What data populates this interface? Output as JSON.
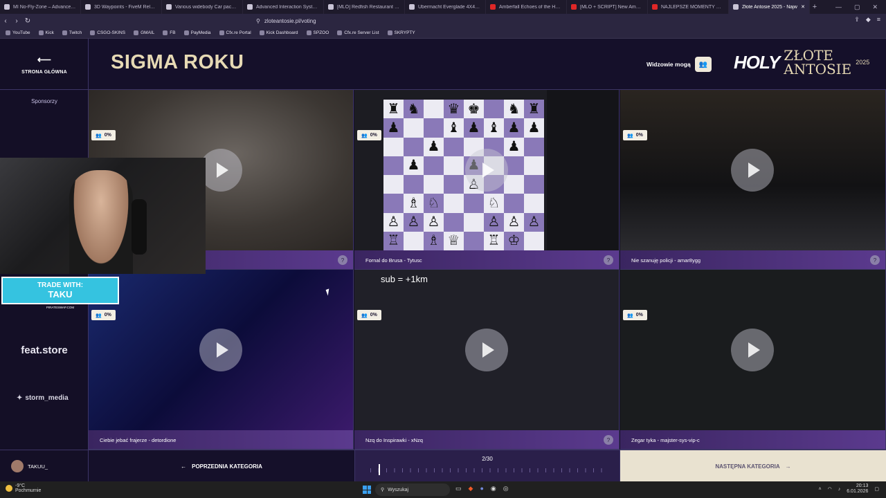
{
  "browser": {
    "tabs": [
      {
        "title": "MI No-Fly-Zone – Advanced Airsp",
        "icon": "site-icon"
      },
      {
        "title": "3D Waypoints - FiveM Releases - C",
        "icon": "site-icon"
      },
      {
        "title": "Various widebody Car pack V5 - Fi",
        "icon": "site-icon"
      },
      {
        "title": "Advanced Interaction System | Tar",
        "icon": "site-icon"
      },
      {
        "title": "[MLO] Redfish Restaurant - BlackV",
        "icon": "site-icon"
      },
      {
        "title": "Ubermacht Everglade 4X4 Wildtrai",
        "icon": "site-icon"
      },
      {
        "title": "Amberfall Echoes of the Headlight",
        "icon": "youtube-icon"
      },
      {
        "title": "[MLO + SCRIPT] New AmmuNatio",
        "icon": "youtube-icon"
      },
      {
        "title": "NAJLEPSZE MOMENTY POLSKIEGO",
        "icon": "youtube-icon"
      },
      {
        "title": "Złote Antosie 2025 - Najw",
        "icon": "site-icon",
        "active": true
      }
    ],
    "url": "zloteantosie.pl/voting",
    "bookmarks": [
      "YouTube",
      "Kick",
      "Twitch",
      "CSGO-SKINS",
      "GMAIL",
      "FB",
      "PayMedia",
      "Cfx.re Portal",
      "Kick Dashboard",
      "SPZOO",
      "Cfx.re Server List",
      "SKRYPTY"
    ]
  },
  "sidebar": {
    "home_label": "STRONA GŁÓWNA",
    "sponsors_label": "Sponsorzy",
    "sponsor_feat": "feat.store",
    "sponsor_storm": "storm_media"
  },
  "header": {
    "category_title": "SIGMA ROKU",
    "viewers_label": "Widzowie mogą",
    "logo_holy": "HOLY",
    "logo_zlote": "ZŁOTE",
    "logo_antosie": "ANTOSIE",
    "logo_year": "2025"
  },
  "videos": [
    {
      "title": "",
      "percent": "0%"
    },
    {
      "title": "Fornal do Brusa - Tytusc",
      "percent": "0%"
    },
    {
      "title": "Nie szanuję policji - amar8ygg",
      "percent": "0%"
    },
    {
      "title": "Ciebie jebać frajerze - detordione",
      "percent": "0%"
    },
    {
      "title": "Nzq do Inspirawki - xNzq",
      "percent": "0%"
    },
    {
      "title": "Zegar tyka - majster-sys-vip-c",
      "percent": "0%"
    }
  ],
  "overlay": {
    "trade_line1": "TRADE WITH:",
    "trade_line2": "TAKU",
    "trade_site": "PIRATESWAP.COM",
    "sub_text": "sub = +1km"
  },
  "footer": {
    "username": "TAKUU_",
    "prev_label": "POPRZEDNIA KATEGORIA",
    "page_indicator": "2/30",
    "next_label": "NASTĘPNA KATEGORIA"
  },
  "taskbar": {
    "weather_temp": "-9°C",
    "weather_desc": "Pochmurnie",
    "search_placeholder": "Wyszukaj",
    "time": "20:13",
    "date": "6.01.2026"
  },
  "colors": {
    "accent_gold": "#e6d9b4",
    "caption_purple": "#5b3a8e",
    "page_bg": "#15102a"
  }
}
